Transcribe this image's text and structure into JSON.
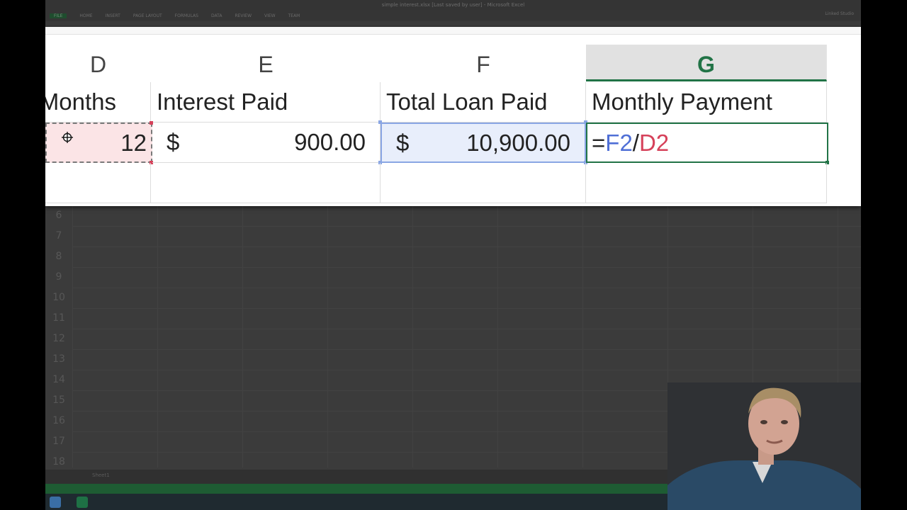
{
  "window": {
    "title": "simple interest.xlsx [Last saved by user] - Microsoft Excel",
    "user": "Linked Studio"
  },
  "ribbon": {
    "tabs": [
      "FILE",
      "HOME",
      "INSERT",
      "PAGE LAYOUT",
      "FORMULAS",
      "DATA",
      "REVIEW",
      "VIEW",
      "TEAM"
    ]
  },
  "zoom": {
    "columns": [
      {
        "label": "D",
        "active": false
      },
      {
        "label": "E",
        "active": false
      },
      {
        "label": "F",
        "active": false
      },
      {
        "label": "G",
        "active": true
      }
    ],
    "row1": {
      "d": "Months",
      "e": "Interest Paid",
      "f": "Total Loan Paid",
      "g": "Monthly Payment"
    },
    "row2": {
      "d_value": "12",
      "e_currency": "$",
      "e_value": "900.00",
      "f_currency": "$",
      "f_value": "10,900.00",
      "g_formula_prefix": "=",
      "g_ref1": "F2",
      "g_operator": "/",
      "g_ref2": "D2"
    }
  },
  "grid": {
    "row_numbers": [
      "6",
      "7",
      "8",
      "9",
      "10",
      "11",
      "12",
      "13",
      "14",
      "15",
      "16",
      "17",
      "18"
    ]
  },
  "sheet": {
    "tab_label": "Sheet1"
  },
  "colors": {
    "accent_green": "#217346",
    "ref_blue": "#4f6fd6",
    "ref_red": "#d6415a"
  },
  "icons": {
    "move_cursor": "move-cursor-icon",
    "excel_taskbar": "excel-icon"
  }
}
